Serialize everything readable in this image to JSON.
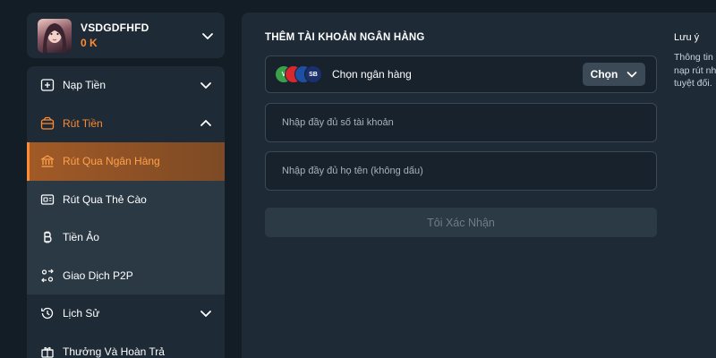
{
  "user": {
    "name": "VSDGDFHFD",
    "balance": "0 K"
  },
  "menu": {
    "deposit": "Nạp Tiền",
    "withdraw": "Rút Tiền",
    "withdraw_items": [
      {
        "label": "Rút Qua Ngân Hàng",
        "icon": "bank-icon",
        "active": true
      },
      {
        "label": "Rút Qua Thẻ Cào",
        "icon": "card-icon",
        "active": false
      },
      {
        "label": "Tiền Ảo",
        "icon": "bitcoin-icon",
        "active": false
      },
      {
        "label": "Giao Dịch P2P",
        "icon": "p2p-icon",
        "active": false
      }
    ],
    "history": "Lịch Sử",
    "rewards": "Thưởng Và Hoàn Trả"
  },
  "form": {
    "title": "THÊM TÀI KHOẢN NGÂN HÀNG",
    "bank_select_label": "Chọn ngân hàng",
    "bank_logos": [
      "V",
      "",
      "",
      "SB"
    ],
    "choose_button": "Chọn",
    "account_number_placeholder": "Nhập đầy đủ số tài khoản",
    "full_name_placeholder": "Nhập đầy đủ họ tên (không dấu)",
    "confirm_button": "Tôi Xác Nhận"
  },
  "note": {
    "title": "Lưu ý",
    "lines": [
      "Thông tin",
      "nạp rút nh",
      "tuyệt đối."
    ]
  },
  "colors": {
    "accent": "#ff8c33",
    "panel": "#1e2a35",
    "background": "#131d26"
  }
}
